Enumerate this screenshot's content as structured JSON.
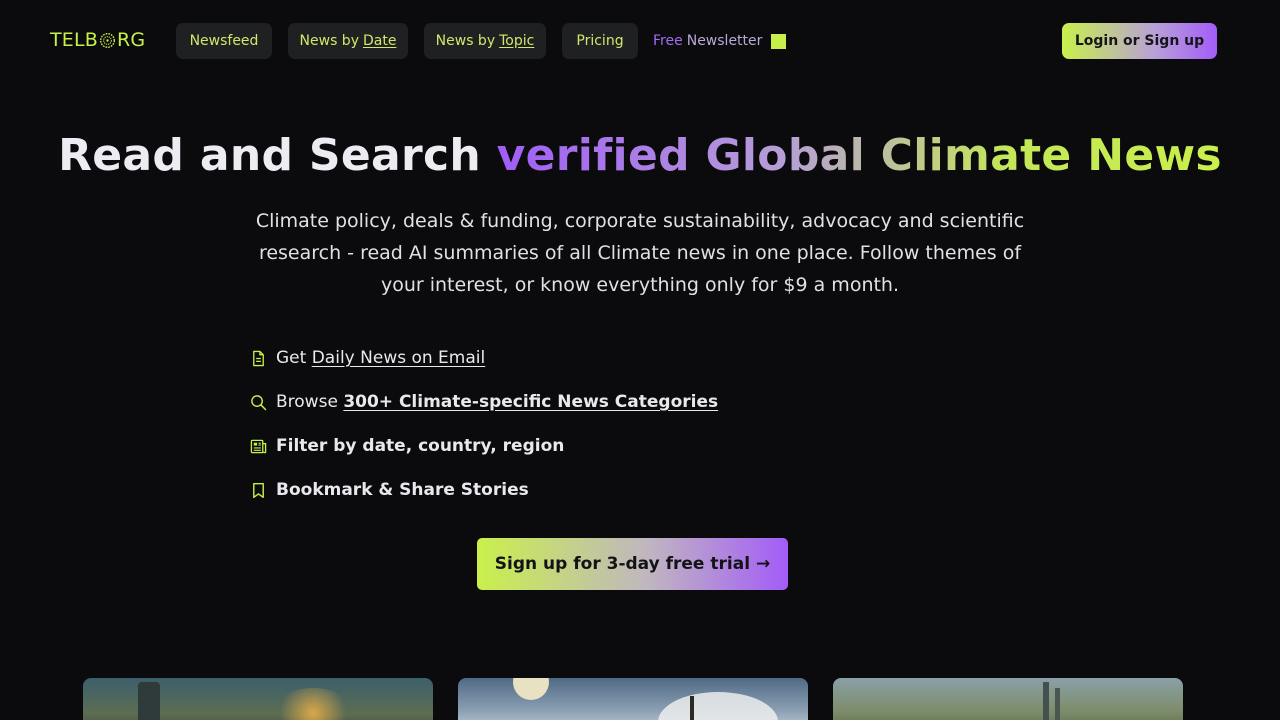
{
  "header": {
    "logo": {
      "left": "TELB",
      "right": "RG"
    },
    "nav": [
      {
        "label": "Newsfeed",
        "suffix": ""
      },
      {
        "label": "News by",
        "suffix": "Date"
      },
      {
        "label": "News by",
        "suffix": "Topic"
      },
      {
        "label": "Pricing",
        "suffix": ""
      }
    ],
    "newsletter": {
      "word1": "Free",
      "word2": "Newsletter"
    },
    "login_label": "Login or Sign up"
  },
  "hero": {
    "title_plain": "Read and Search ",
    "title_gradient": "verified Global Climate News",
    "subtitle": "Climate policy, deals & funding, corporate sustainability, advocacy and scientific research - read AI summaries of all Climate news in one place. Follow themes of your interest, or know everything only for $9 a month."
  },
  "features": [
    {
      "icon": "document-icon",
      "prefix": "Get",
      "link": "Daily News on Email"
    },
    {
      "icon": "search-icon",
      "prefix": "Browse",
      "link": "300+ Climate-specific News Categories"
    },
    {
      "icon": "newspaper-icon",
      "text": "Filter by date, country, region"
    },
    {
      "icon": "bookmark-icon",
      "text": "Bookmark & Share Stories"
    }
  ],
  "cta_label": "Sign up for 3-day free trial →",
  "colors": {
    "accent_green": "#c9f04b",
    "accent_purple": "#a35cf8",
    "background": "#0b0b0d",
    "nav_pill": "#1f2022"
  }
}
